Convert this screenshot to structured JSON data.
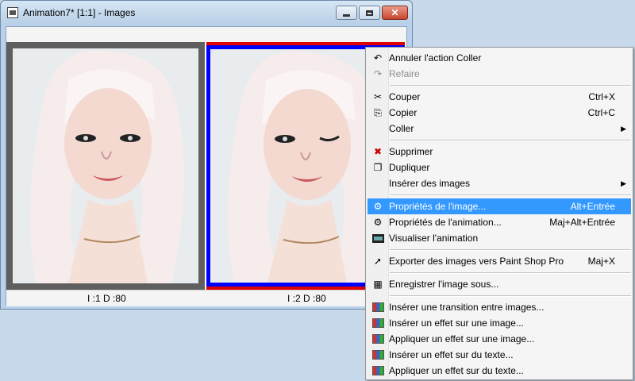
{
  "window": {
    "title": "Animation7* [1:1] - Images",
    "buttons": {
      "close": "✕"
    },
    "frames": [
      {
        "label": "I :1   D :80"
      },
      {
        "label": "I :2   D :80"
      }
    ]
  },
  "menu": {
    "items": [
      {
        "label": "Annuler l'action Coller",
        "shortcut": "",
        "icon": "undo-icon",
        "glyph": "↶"
      },
      {
        "label": "Refaire",
        "shortcut": "",
        "icon": "redo-icon",
        "glyph": "↷"
      },
      {
        "label": "Couper",
        "shortcut": "Ctrl+X",
        "icon": "scissors-icon",
        "glyph": "✂"
      },
      {
        "label": "Copier",
        "shortcut": "Ctrl+C",
        "icon": "copy-icon",
        "glyph": "⎘"
      },
      {
        "label": "Coller",
        "shortcut": "",
        "icon": "",
        "glyph": "",
        "arrow": "▶"
      },
      {
        "label": "Supprimer",
        "shortcut": "",
        "icon": "delete-icon",
        "glyph": "✖"
      },
      {
        "label": "Dupliquer",
        "shortcut": "",
        "icon": "duplicate-icon",
        "glyph": "❐"
      },
      {
        "label": "Insérer des images",
        "shortcut": "",
        "icon": "",
        "glyph": "",
        "arrow": "▶"
      },
      {
        "label": "Propriétés de l'image...",
        "shortcut": "Alt+Entrée",
        "icon": "frame-properties-icon",
        "glyph": "⚙"
      },
      {
        "label": "Propriétés de l'animation...",
        "shortcut": "Maj+Alt+Entrée",
        "icon": "animation-properties-icon",
        "glyph": "⚙"
      },
      {
        "label": "Visualiser l'animation",
        "shortcut": "",
        "icon": "view-animation-icon",
        "glyph": ""
      },
      {
        "label": "Exporter des images vers Paint Shop Pro",
        "shortcut": "Maj+X",
        "icon": "export-icon",
        "glyph": "➚"
      },
      {
        "label": "Enregistrer l'image sous...",
        "shortcut": "",
        "icon": "save-frame-icon",
        "glyph": "▦"
      },
      {
        "label": "Insérer une transition entre images...",
        "shortcut": "",
        "icon": "transition-icon",
        "glyph": ""
      },
      {
        "label": "Insérer un effet sur une image...",
        "shortcut": "",
        "icon": "insert-image-effect-icon",
        "glyph": ""
      },
      {
        "label": "Appliquer un effet sur une image...",
        "shortcut": "",
        "icon": "apply-image-effect-icon",
        "glyph": ""
      },
      {
        "label": "Insérer un effet sur du texte...",
        "shortcut": "",
        "icon": "insert-text-effect-icon",
        "glyph": ""
      },
      {
        "label": "Appliquer un effet sur du texte...",
        "shortcut": "",
        "icon": "apply-text-effect-icon",
        "glyph": ""
      }
    ]
  },
  "colors": {
    "menu_highlight": "#3399ff",
    "selected_frame_outer": "#e00000",
    "selected_frame_inner": "#0000ff"
  }
}
